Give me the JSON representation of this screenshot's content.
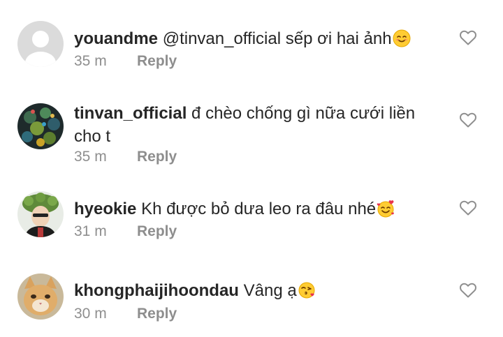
{
  "comments": [
    {
      "username": "youandme",
      "text": "@tinvan_official sếp ơi hai ảnh",
      "emoji": "smiling-face-icon",
      "time": "35 m",
      "reply": "Reply"
    },
    {
      "username": "tinvan_official",
      "text": "đ chèo chống gì nữa cưới liền cho t",
      "emoji": "",
      "time": "35 m",
      "reply": "Reply"
    },
    {
      "username": "hyeokie",
      "text": "Kh được bỏ dưa leo ra đâu nhé",
      "emoji": "smiling-face-with-hearts-icon",
      "time": "31 m",
      "reply": "Reply"
    },
    {
      "username": "khongphaijihoondau",
      "text": "Vâng ạ",
      "emoji": "face-blowing-kiss-icon",
      "time": "30 m",
      "reply": "Reply"
    }
  ],
  "colors": {
    "text": "#262626",
    "meta": "#8e8e8e",
    "like_icon": "#8e8e8e",
    "default_avatar_bg": "#dbdbdb"
  }
}
